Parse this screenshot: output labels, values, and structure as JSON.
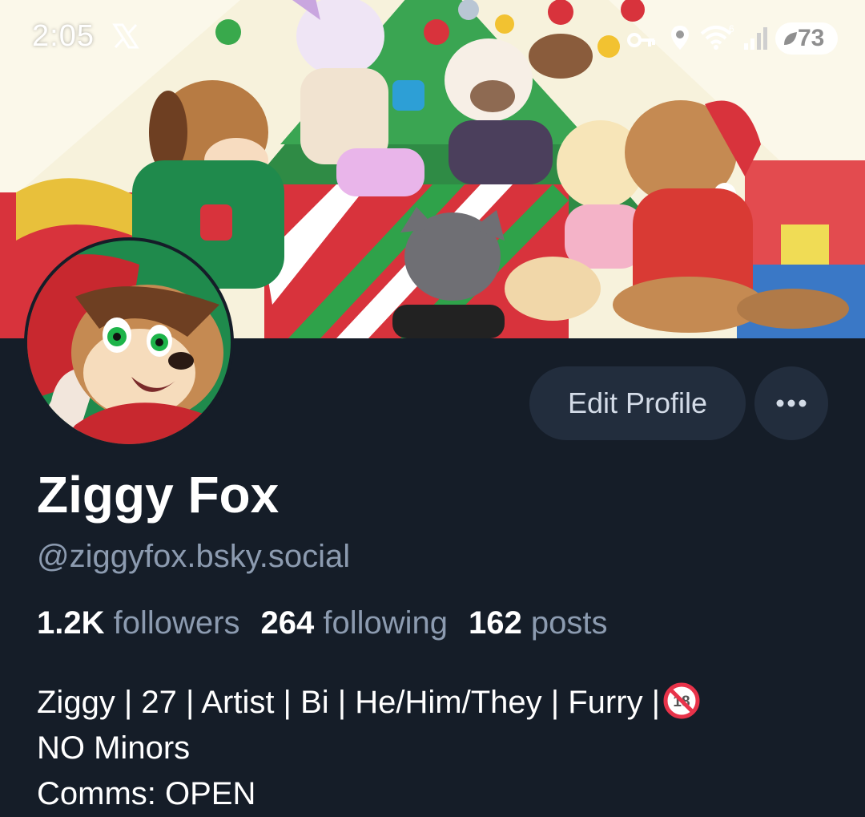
{
  "status_bar": {
    "time": "2:05",
    "battery": "73",
    "icons": [
      "x-logo-icon",
      "key-icon",
      "location-icon",
      "wifi-icon",
      "signal-icon",
      "battery-icon"
    ]
  },
  "profile": {
    "display_name": "Ziggy Fox",
    "handle": "@ziggyfox.bsky.social",
    "stats": {
      "followers_count": "1.2K",
      "followers_label": "followers",
      "following_count": "264",
      "following_label": "following",
      "posts_count": "162",
      "posts_label": "posts"
    },
    "bio_lines": [
      "Ziggy | 27 | Artist | Bi | He/Him/They | Furry |",
      "NO Minors",
      "Comms: OPEN"
    ]
  },
  "buttons": {
    "edit_profile": "Edit Profile",
    "more": "more-options-icon"
  },
  "colors": {
    "background": "#151d28",
    "button_bg": "#222d3d",
    "muted_text": "#8c9bb0",
    "no_minors_badge": "#e8334a"
  }
}
